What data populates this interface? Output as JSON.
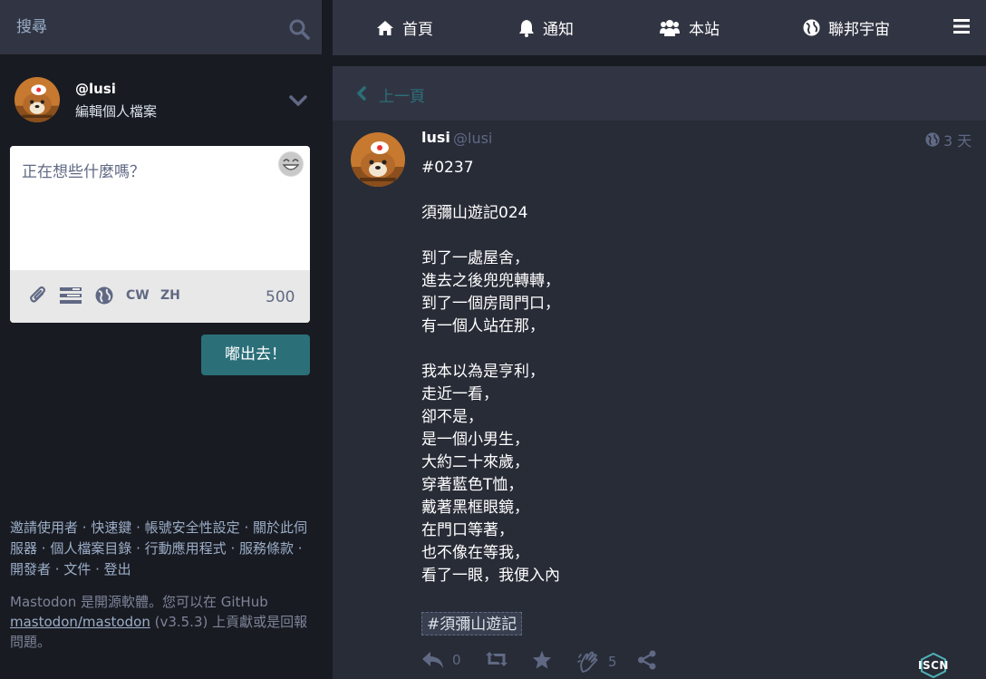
{
  "search": {
    "placeholder": "搜尋"
  },
  "account": {
    "handle": "@lusi",
    "edit_label": "編輯個人檔案"
  },
  "composer": {
    "placeholder": "正在想些什麼嗎？",
    "cw_label": "CW",
    "lang_label": "ZH",
    "char_count": "500",
    "publish_label": "嘟出去！"
  },
  "footer": {
    "links": [
      "邀請使用者",
      "快速鍵",
      "帳號安全性設定",
      "關於此伺服器",
      "個人檔案目錄",
      "行動應用程式",
      "服務條款",
      "開發者",
      "文件",
      "登出"
    ],
    "about_prefix": "Mastodon 是開源軟體。您可以在 GitHub ",
    "repo_link": "mastodon/mastodon",
    "about_suffix": " (v3.5.3) 上貢獻或是回報問題。"
  },
  "nav": {
    "home": "首頁",
    "notifications": "通知",
    "local": "本站",
    "federated": "聯邦宇宙"
  },
  "back": {
    "label": "上一頁"
  },
  "status": {
    "display_name": "lusi",
    "handle": "@lusi",
    "relative_time": "3 天",
    "paragraphs": [
      [
        "#0237"
      ],
      [
        "須彌山遊記024"
      ],
      [
        "到了一處屋舍，",
        "進去之後兜兜轉轉，",
        "到了一個房間門口，",
        "有一個人站在那，"
      ],
      [
        "我本以為是亨利，",
        "走近一看，",
        "卻不是，",
        "是一個小男生，",
        "大約二十來歲，",
        "穿著藍色T恤，",
        "戴著黑框眼鏡，",
        "在門口等著，",
        "也不像在等我，",
        "看了一眼，我便入內"
      ]
    ],
    "hashtag": "#須彌山遊記",
    "replies": "0",
    "emoji_reactions": "5",
    "iscn_label": "ISCN"
  }
}
